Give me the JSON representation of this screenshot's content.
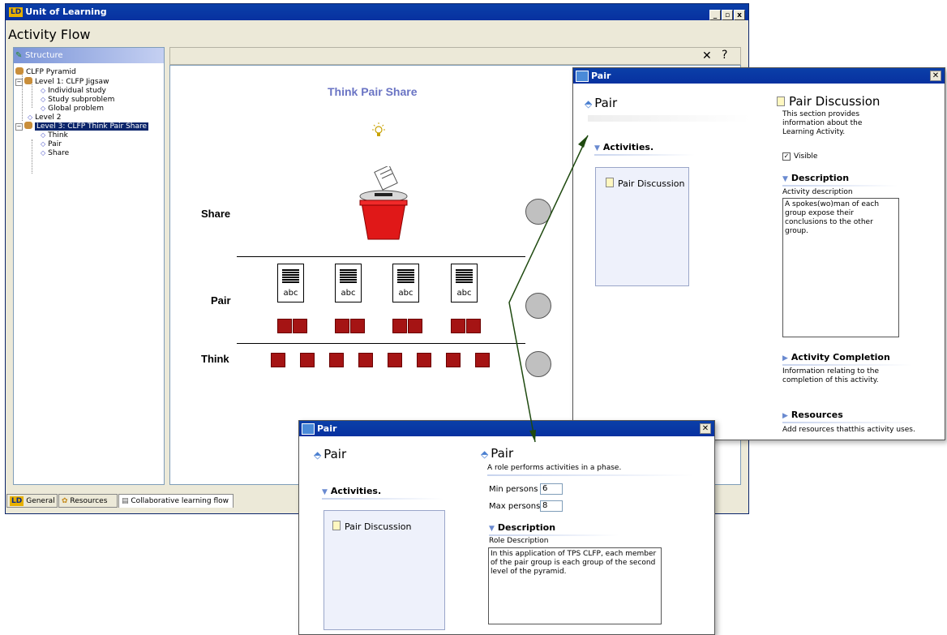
{
  "main_window": {
    "title": "Unit of Learning",
    "logo": "LD",
    "heading": "Activity Flow",
    "controls": [
      "_",
      "▫",
      "x"
    ]
  },
  "structure": {
    "header": "Structure",
    "root": "CLFP Pyramid",
    "level1": "Level 1: CLFP Jigsaw",
    "level1_items": [
      "Individual study",
      "Study subproblem",
      "Global problem"
    ],
    "level2": "Level 2",
    "level3": "Level 3: CLFP Think Pair Share",
    "level3_items": [
      "Think",
      "Pair",
      "Share"
    ]
  },
  "canvas": {
    "close": "✕",
    "help": "?",
    "title": "Think Pair Share",
    "stages": [
      "Share",
      "Pair",
      "Think"
    ],
    "doc_label": "abc"
  },
  "tabs": [
    "General",
    "Resources",
    "Collaborative learning flow"
  ],
  "dialog_right": {
    "title": "Pair",
    "role_title": "Pair",
    "activities_label": "Activities.",
    "activity_item": "Pair Discussion",
    "detail_title": "Pair Discussion",
    "detail_desc": "This section provides information about the Learning Activity.",
    "visible_label": "Visible",
    "description_label": "Description",
    "activity_description_label": "Activity description",
    "activity_description_text": "A spokes(wo)man of each group expose their conclusions to the other group.",
    "completion_label": "Activity Completion",
    "completion_desc": "Information relating to the completion of this activity.",
    "resources_label": "Resources",
    "resources_desc": "Add resources thatthis activity uses."
  },
  "dialog_bottom": {
    "title": "Pair",
    "role_title": "Pair",
    "activities_label": "Activities.",
    "activity_item": "Pair Discussion",
    "detail_title": "Pair",
    "detail_desc": "A role performs activities in a phase.",
    "min_label": "Min persons",
    "min_value": "6",
    "max_label": "Max persons",
    "max_value": "8",
    "description_label": "Description",
    "role_description_label": "Role Description",
    "role_description_text": "In this application of TPS CLFP, each member of the pair group is each group of the second level of the pyramid."
  },
  "colors": {
    "titlebar": "#0a3fa8",
    "accent_title": "#6a74c4",
    "square_red": "#a51414",
    "bucket_red": "#e01818",
    "arrow_green": "#1f4a10"
  }
}
